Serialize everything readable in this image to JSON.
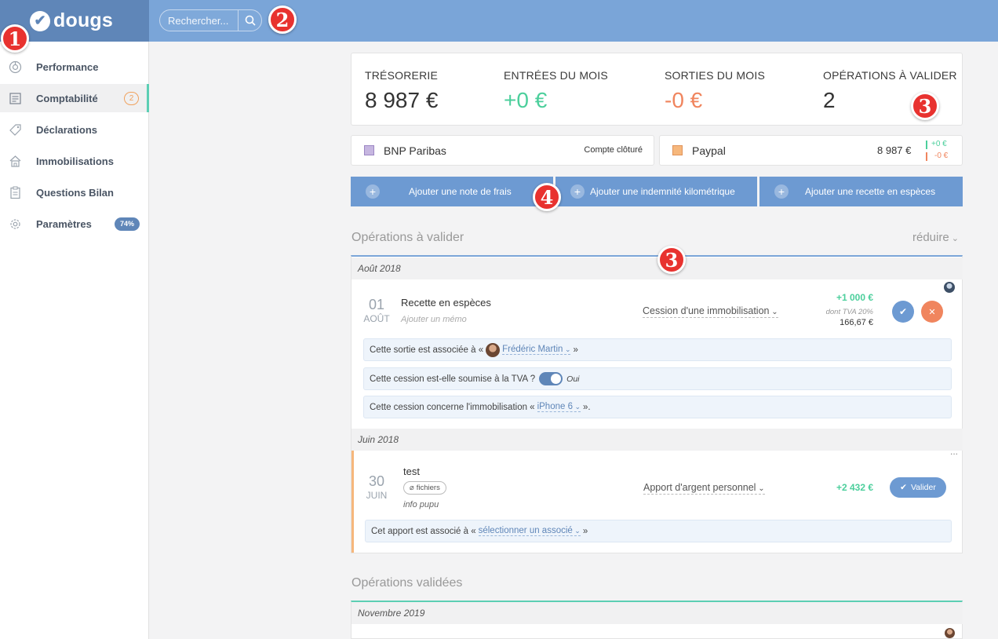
{
  "app": {
    "name": "dougs"
  },
  "search": {
    "placeholder": "Rechercher..."
  },
  "markers": [
    "1",
    "2",
    "3",
    "4"
  ],
  "sidebar": {
    "items": [
      {
        "label": "Performance",
        "icon": "performance-icon"
      },
      {
        "label": "Comptabilité",
        "icon": "document-icon",
        "badge": "2",
        "active": true
      },
      {
        "label": "Déclarations",
        "icon": "tag-icon"
      },
      {
        "label": "Immobilisations",
        "icon": "building-icon"
      },
      {
        "label": "Questions Bilan",
        "icon": "clipboard-icon"
      },
      {
        "label": "Paramètres",
        "icon": "gear-icon",
        "badge": "74%"
      }
    ]
  },
  "kpis": {
    "tresorerie": {
      "label": "TRÉSORERIE",
      "value": "8 987 €"
    },
    "entrees": {
      "label": "ENTRÉES DU MOIS",
      "value": "+0 €"
    },
    "sorties": {
      "label": "SORTIES DU MOIS",
      "value": "-0 €"
    },
    "operations": {
      "label": "OPÉRATIONS À VALIDER",
      "value": "2"
    }
  },
  "accounts": {
    "bnp": {
      "name": "BNP Paribas",
      "status": "Compte clôturé",
      "color": "#c6b6e0"
    },
    "paypal": {
      "name": "Paypal",
      "balance": "8 987 €",
      "in": "+0 €",
      "out": "-0 €",
      "color": "#f6b77c"
    }
  },
  "actions": {
    "note_frais": "Ajouter une note de frais",
    "indemnite": "Ajouter une indemnité kilométrique",
    "recette": "Ajouter une recette en espèces"
  },
  "pending": {
    "title": "Opérations à valider",
    "collapse": "réduire",
    "months": [
      "Août 2018",
      "Juin 2018"
    ],
    "op1": {
      "day": "01",
      "month": "AOÛT",
      "title": "Recette en espèces",
      "memo": "Ajouter un mémo",
      "category": "Cession d'une immobilisation",
      "amount": "+1 000 €",
      "vat_label": "dont TVA 20%",
      "vat_amount": "166,67 €",
      "assoc": {
        "prefix": "Cette sortie est associée à «",
        "name": "Frédéric Martin",
        "suffix": "»"
      },
      "tva_question": {
        "text": "Cette cession est-elle soumise à la TVA ?",
        "answer": "Oui"
      },
      "asset": {
        "prefix": "Cette cession concerne l'immobilisation «",
        "name": "iPhone 6",
        "suffix": "»."
      }
    },
    "op2": {
      "day": "30",
      "month": "JUIN",
      "title": "test",
      "files": "fichiers",
      "memo": "info pupu",
      "category": "Apport d'argent personnel",
      "amount": "+2 432 €",
      "validate": "Valider",
      "more": "...",
      "assoc": {
        "prefix": "Cet apport est associé à «",
        "name": "sélectionner un associé",
        "suffix": "»"
      }
    }
  },
  "validated": {
    "title": "Opérations validées",
    "months": [
      "Novembre 2019"
    ]
  }
}
